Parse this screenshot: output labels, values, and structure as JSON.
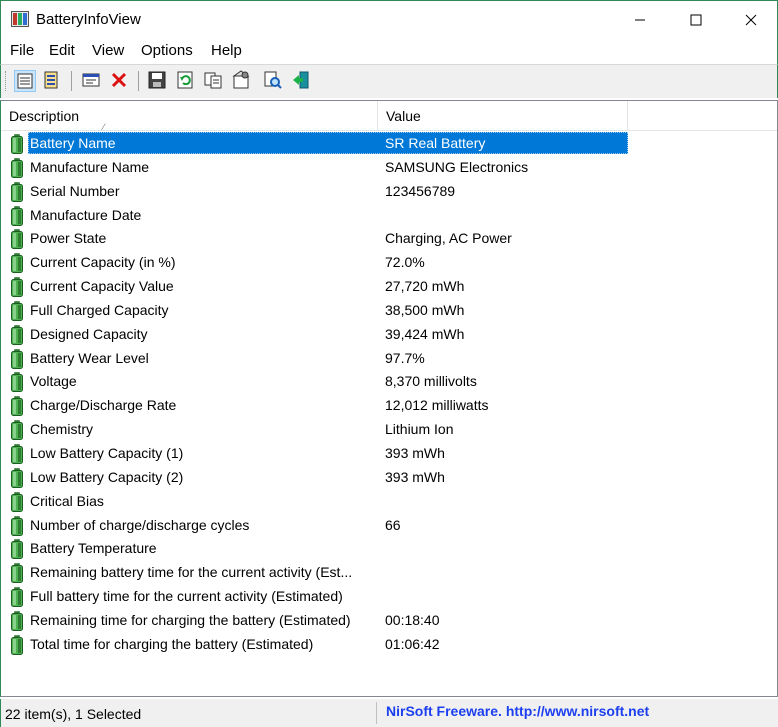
{
  "window": {
    "title": "BatteryInfoView"
  },
  "menu": [
    "File",
    "Edit",
    "View",
    "Options",
    "Help"
  ],
  "toolbar": {
    "buttons": [
      {
        "name": "view-details-icon"
      },
      {
        "name": "view-list-icon"
      },
      {
        "name": "properties-window-icon"
      },
      {
        "name": "delete-x-icon"
      },
      {
        "name": "save-disk-icon"
      },
      {
        "name": "refresh-icon"
      },
      {
        "name": "copy-icon"
      },
      {
        "name": "html-report-icon"
      },
      {
        "name": "find-icon"
      },
      {
        "name": "exit-door-icon"
      }
    ]
  },
  "columns": {
    "description": "Description",
    "value": "Value"
  },
  "rows": [
    {
      "desc": "Battery Name",
      "value": "SR Real Battery"
    },
    {
      "desc": "Manufacture Name",
      "value": "SAMSUNG Electronics"
    },
    {
      "desc": "Serial Number",
      "value": "123456789"
    },
    {
      "desc": "Manufacture Date",
      "value": ""
    },
    {
      "desc": "Power State",
      "value": "Charging, AC Power"
    },
    {
      "desc": "Current Capacity (in %)",
      "value": "72.0%"
    },
    {
      "desc": "Current Capacity Value",
      "value": "27,720 mWh"
    },
    {
      "desc": "Full Charged Capacity",
      "value": "38,500 mWh"
    },
    {
      "desc": "Designed Capacity",
      "value": "39,424 mWh"
    },
    {
      "desc": "Battery Wear Level",
      "value": "97.7%"
    },
    {
      "desc": "Voltage",
      "value": "8,370 millivolts"
    },
    {
      "desc": "Charge/Discharge Rate",
      "value": "12,012 milliwatts"
    },
    {
      "desc": "Chemistry",
      "value": "Lithium Ion"
    },
    {
      "desc": "Low Battery Capacity (1)",
      "value": "393 mWh"
    },
    {
      "desc": "Low Battery Capacity (2)",
      "value": "393 mWh"
    },
    {
      "desc": "Critical Bias",
      "value": ""
    },
    {
      "desc": "Number of charge/discharge cycles",
      "value": "66"
    },
    {
      "desc": "Battery Temperature",
      "value": ""
    },
    {
      "desc": "Remaining battery time for the current activity (Est...",
      "value": ""
    },
    {
      "desc": "Full battery time for the current activity (Estimated)",
      "value": ""
    },
    {
      "desc": "Remaining time for charging the battery (Estimated)",
      "value": "00:18:40"
    },
    {
      "desc": "Total  time for charging the battery (Estimated)",
      "value": "01:06:42"
    }
  ],
  "selected_row": 0,
  "status": {
    "items": "22 item(s), 1 Selected",
    "credit": "NirSoft Freeware.  http://www.nirsoft.net"
  }
}
